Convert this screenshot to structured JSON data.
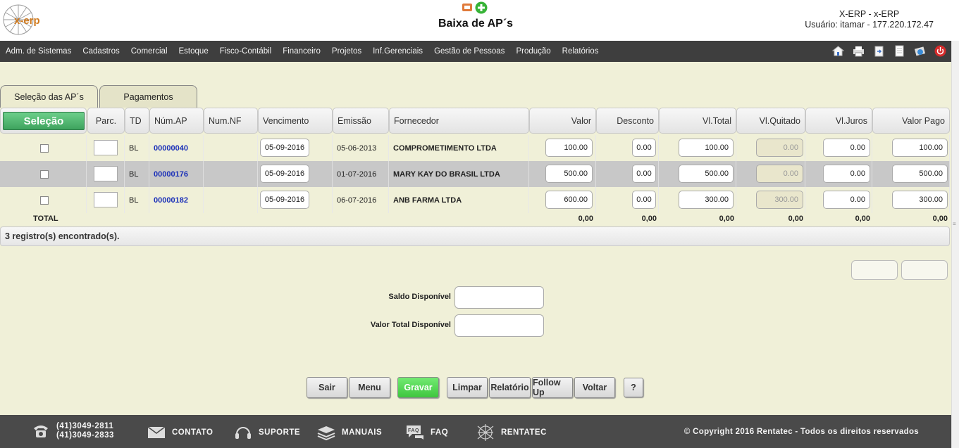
{
  "app": {
    "logo_text": "x-erp",
    "page_title": "Baixa de AP´s",
    "user_line1": "X-ERP - x-ERP",
    "user_line2": "Usuário: itamar - 177.220.172.47"
  },
  "menu": [
    "Adm. de Sistemas",
    "Cadastros",
    "Comercial",
    "Estoque",
    "Fisco-Contábil",
    "Financeiro",
    "Projetos",
    "Inf.Gerenciais",
    "Gestão de Pessoas",
    "Produção",
    "Relatórios"
  ],
  "toolbar_icons": [
    "home-icon",
    "print-icon",
    "export-icon",
    "document-icon",
    "help-icon",
    "power-icon"
  ],
  "tabs": {
    "selecao": "Seleção das AP´s",
    "pagamentos": "Pagamentos"
  },
  "grid": {
    "select_button": "Seleção",
    "headers": {
      "parc": "Parc.",
      "td": "TD",
      "num_ap": "Núm.AP",
      "num_nf": "Num.NF",
      "vencimento": "Vencimento",
      "emissao": "Emissão",
      "fornecedor": "Fornecedor",
      "valor": "Valor",
      "desconto": "Desconto",
      "vl_total": "Vl.Total",
      "vl_quitado": "Vl.Quitado",
      "vl_juros": "Vl.Juros",
      "valor_pago": "Valor Pago"
    },
    "rows": [
      {
        "td": "BL",
        "num_ap": "00000040",
        "vencimento": "05-09-2016",
        "emissao": "05-06-2013",
        "fornecedor": "COMPROMETIMENTO LTDA",
        "valor": "100.00",
        "desconto": "0.00",
        "vl_total": "100.00",
        "vl_quitado": "0.00",
        "vl_juros": "0.00",
        "valor_pago": "100.00"
      },
      {
        "td": "BL",
        "num_ap": "00000176",
        "vencimento": "05-09-2016",
        "emissao": "01-07-2016",
        "fornecedor": "MARY KAY DO BRASIL LTDA",
        "valor": "500.00",
        "desconto": "0.00",
        "vl_total": "500.00",
        "vl_quitado": "0.00",
        "vl_juros": "0.00",
        "valor_pago": "500.00"
      },
      {
        "td": "BL",
        "num_ap": "00000182",
        "vencimento": "05-09-2016",
        "emissao": "06-07-2016",
        "fornecedor": "ANB FARMA LTDA",
        "valor": "600.00",
        "desconto": "0.00",
        "vl_total": "300.00",
        "vl_quitado": "300.00",
        "vl_juros": "0.00",
        "valor_pago": "300.00"
      }
    ],
    "total": {
      "label": "TOTAL",
      "valor": "0,00",
      "desconto": "0,00",
      "vl_total": "0,00",
      "vl_quitado": "0,00",
      "vl_juros": "0,00",
      "valor_pago": "0,00"
    },
    "records": "3 registro(s) encontrado(s)."
  },
  "form": {
    "saldo_label": "Saldo Disponível",
    "valor_total_label": "Valor Total Disponível"
  },
  "buttons": {
    "sair": "Sair",
    "menu": "Menu",
    "gravar": "Gravar",
    "limpar": "Limpar",
    "relatorio": "Relatório",
    "follow_up": "Follow Up",
    "voltar": "Voltar",
    "help": "?"
  },
  "footer": {
    "phone1": "(41)3049-2811",
    "phone2": "(41)3049-2833",
    "contato": "CONTATO",
    "suporte": "SUPORTE",
    "manuais": "MANUAIS",
    "faq": "FAQ",
    "rentatec": "RENTATEC",
    "copyright": "© Copyright 2016 Rentatec - Todos os direitos reservados"
  },
  "colors": {
    "background": "#f0f0d8",
    "menubar": "#3e3e3e",
    "footer": "#4a4a4a",
    "select_button": "#4cb46b",
    "save_button": "#4fd44f",
    "link": "#1a2fb8"
  }
}
